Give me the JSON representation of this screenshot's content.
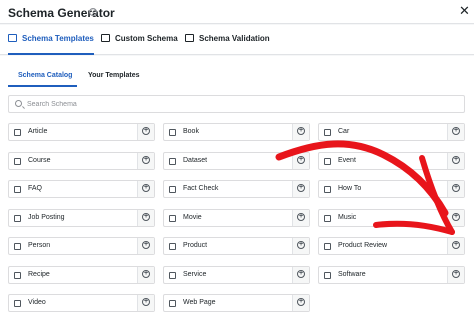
{
  "header": {
    "title": "Schema Generator",
    "help_icon": "question-circle-icon",
    "close_label": "✕"
  },
  "main_tabs": [
    {
      "label": "Schema Templates",
      "icon": "document-icon",
      "active": true
    },
    {
      "label": "Custom Schema",
      "icon": "edit-icon",
      "active": false
    },
    {
      "label": "Schema Validation",
      "icon": "code-window-icon",
      "active": false
    }
  ],
  "sub_tabs": [
    {
      "label": "Schema Catalog",
      "active": true
    },
    {
      "label": "Your Templates",
      "active": false
    }
  ],
  "search": {
    "placeholder": "Search Schema",
    "value": ""
  },
  "schemas": [
    {
      "label": "Article",
      "icon": "article-icon"
    },
    {
      "label": "Book",
      "icon": "book-icon"
    },
    {
      "label": "Car",
      "icon": "car-icon"
    },
    {
      "label": "Course",
      "icon": "course-icon"
    },
    {
      "label": "Dataset",
      "icon": "dataset-icon"
    },
    {
      "label": "Event",
      "icon": "calendar-icon"
    },
    {
      "label": "FAQ",
      "icon": "faq-icon"
    },
    {
      "label": "Fact Check",
      "icon": "fact-check-icon"
    },
    {
      "label": "How To",
      "icon": "howto-icon"
    },
    {
      "label": "Job Posting",
      "icon": "briefcase-icon"
    },
    {
      "label": "Movie",
      "icon": "movie-icon"
    },
    {
      "label": "Music",
      "icon": "music-icon"
    },
    {
      "label": "Person",
      "icon": "person-icon"
    },
    {
      "label": "Product",
      "icon": "cart-icon"
    },
    {
      "label": "Product Review",
      "icon": "review-icon"
    },
    {
      "label": "Recipe",
      "icon": "recipe-icon"
    },
    {
      "label": "Service",
      "icon": "service-icon"
    },
    {
      "label": "Software",
      "icon": "software-icon"
    },
    {
      "label": "Video",
      "icon": "video-icon"
    },
    {
      "label": "Web Page",
      "icon": "webpage-icon"
    }
  ],
  "colors": {
    "accent": "#1f5ebd",
    "arrow": "#e8151b"
  }
}
